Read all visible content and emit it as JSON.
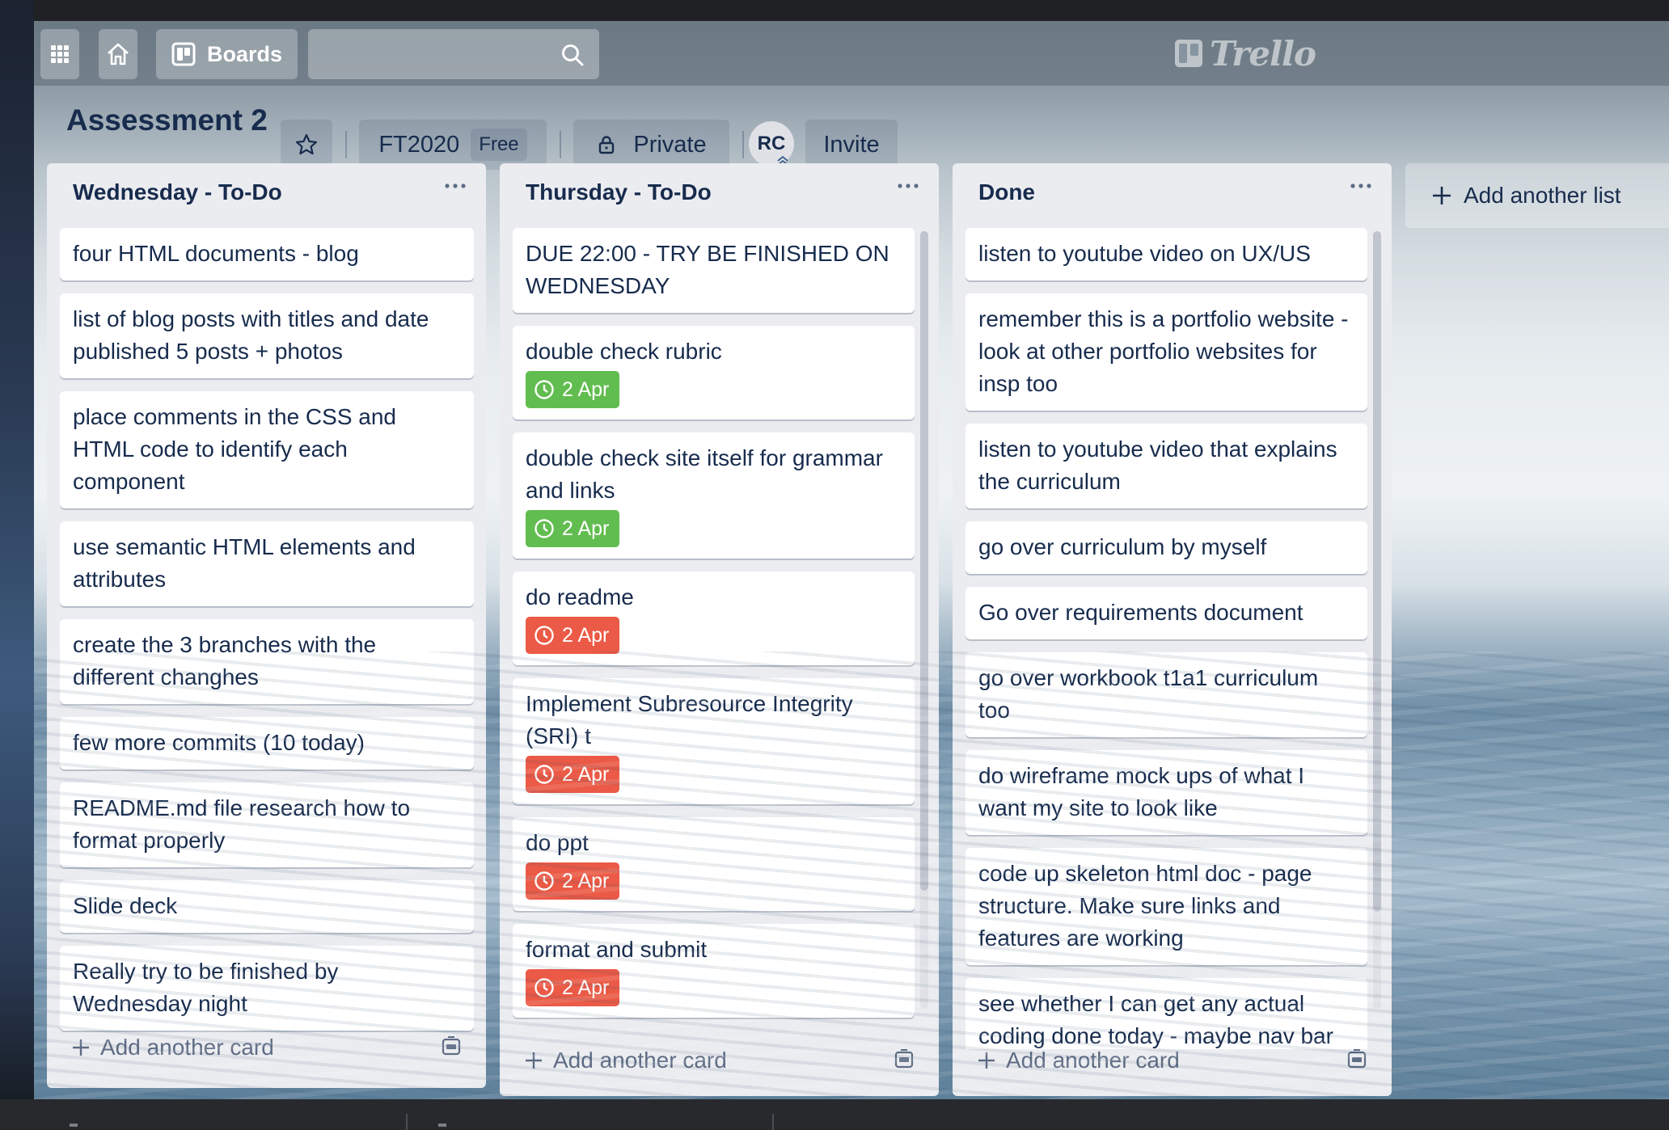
{
  "header": {
    "boards_label": "Boards",
    "search_placeholder": "",
    "logo_text": "Trello"
  },
  "board": {
    "title": "Assessment 2",
    "team": "FT2020",
    "plan_badge": "Free",
    "visibility": "Private",
    "member_initials": "RC",
    "invite_label": "Invite"
  },
  "lists": [
    {
      "title": "Wednesday - To-Do",
      "cards": [
        {
          "title": "four HTML documents - blog"
        },
        {
          "title": "list of blog posts with titles and date published 5 posts + photos"
        },
        {
          "title": "place comments in the CSS and HTML code to identify each component"
        },
        {
          "title": "use semantic HTML elements and attributes"
        },
        {
          "title": "create the 3 branches with the different changhes"
        },
        {
          "title": "few more commits (10 today)"
        },
        {
          "title": "README.md file research how to format properly"
        },
        {
          "title": "Slide deck"
        },
        {
          "title": "Really try to be finished by Wednesday night"
        }
      ],
      "add_card_label": "Add another card"
    },
    {
      "title": "Thursday - To-Do",
      "cards": [
        {
          "title": "DUE 22:00 - TRY BE FINISHED ON WEDNESDAY"
        },
        {
          "title": "double check rubric",
          "due": "2 Apr",
          "due_color": "#61bd4f"
        },
        {
          "title": "double check site itself for grammar and links",
          "due": "2 Apr",
          "due_color": "#61bd4f"
        },
        {
          "title": "do readme",
          "due": "2 Apr",
          "due_color": "#eb5a46"
        },
        {
          "title": "Implement Subresource Integrity (SRI) t",
          "due": "2 Apr",
          "due_color": "#eb5a46"
        },
        {
          "title": "do ppt",
          "due": "2 Apr",
          "due_color": "#eb5a46"
        },
        {
          "title": "format and submit",
          "due": "2 Apr",
          "due_color": "#eb5a46"
        }
      ],
      "add_card_label": "Add another card"
    },
    {
      "title": "Done",
      "cards": [
        {
          "title": "listen to youtube video on UX/US"
        },
        {
          "title": "remember this is a portfolio website - look at other portfolio websites for insp too"
        },
        {
          "title": "listen to youtube video that explains the curriculum"
        },
        {
          "title": "go over curriculum by myself"
        },
        {
          "title": "Go over requirements document"
        },
        {
          "title": "go over workbook t1a1 curriculum too"
        },
        {
          "title": "do wireframe mock ups of what I want my site to look like"
        },
        {
          "title": "code up skeleton html doc - page structure. Make sure links and features are working"
        },
        {
          "title": "see whether I can get any actual coding done today - maybe nav bar"
        }
      ],
      "add_card_label": "Add another card"
    }
  ],
  "add_list_label": "Add another list",
  "colors": {
    "due_green": "#61bd4f",
    "due_red": "#eb5a46",
    "list_bg": "#ebecf0",
    "text": "#172b4d"
  }
}
